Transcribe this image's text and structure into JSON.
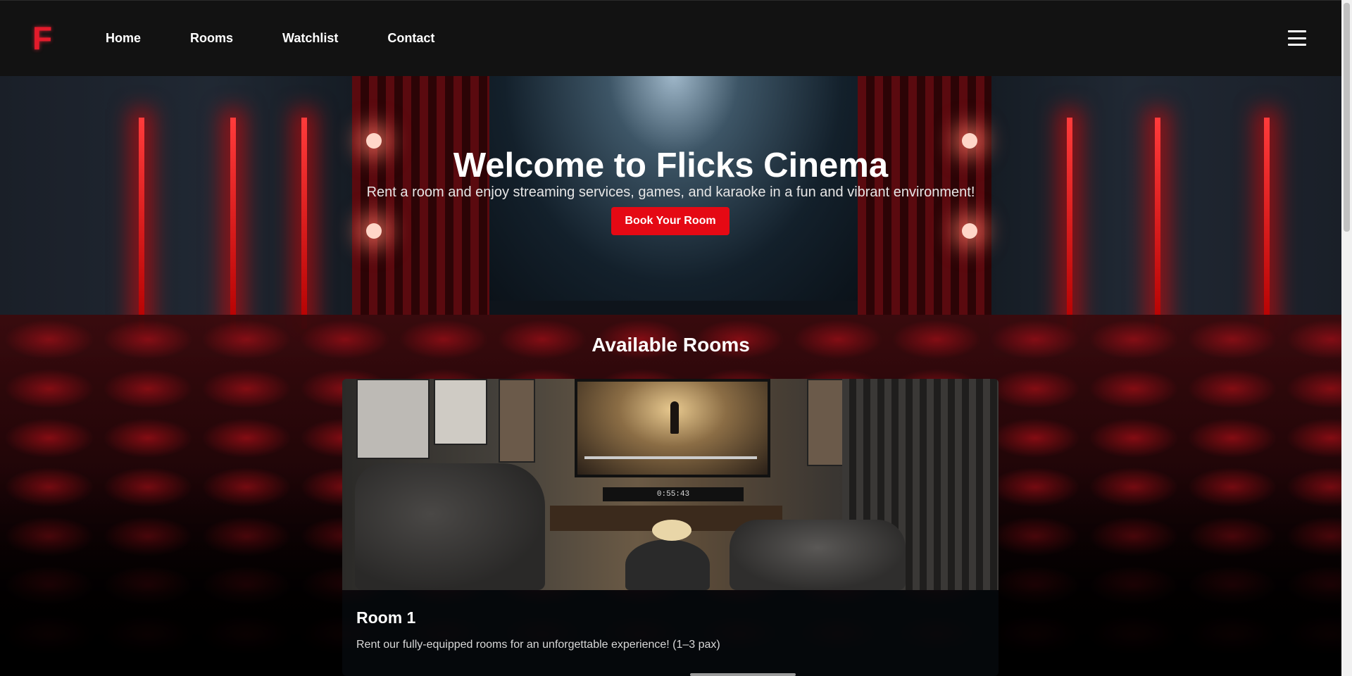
{
  "nav": {
    "logo": "F",
    "links": [
      "Home",
      "Rooms",
      "Watchlist",
      "Contact"
    ]
  },
  "hero": {
    "title": "Welcome to Flicks Cinema",
    "subtitle": "Rent a room and enjoy streaming services, games, and karaoke in a fun and vibrant environment!",
    "cta": "Book Your Room"
  },
  "rooms_section": {
    "title": "Available Rooms",
    "rooms": [
      {
        "name": "Room 1",
        "description": "Rent our fully-equipped rooms for an unforgettable experience! (1–3 pax)",
        "screen_timer": "0:55:43"
      }
    ]
  },
  "colors": {
    "accent": "#e50914",
    "nav_bg": "#121212"
  }
}
